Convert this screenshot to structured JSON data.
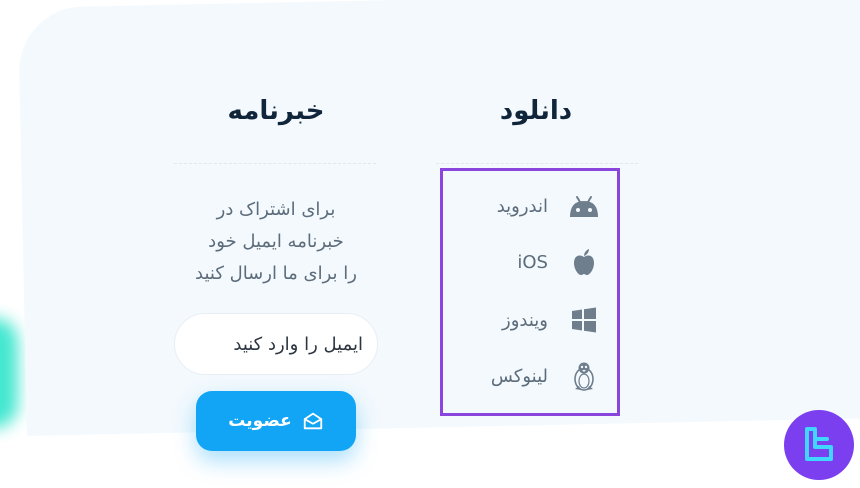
{
  "newsletter": {
    "title": "خبرنامه",
    "description_lines": [
      "برای اشتراک در",
      "خبرنامه ایمیل خود",
      "را برای ما ارسال کنید"
    ],
    "email_placeholder": "ایمیل را وارد کنید",
    "subscribe_label": "عضویت",
    "subscribe_icon": "envelope-open-icon"
  },
  "download": {
    "title": "دانلود",
    "items": [
      {
        "label": "اندروید",
        "icon": "android-icon"
      },
      {
        "label": "iOS",
        "icon": "apple-icon"
      },
      {
        "label": "ویندوز",
        "icon": "windows-icon"
      },
      {
        "label": "لینوکس",
        "icon": "linux-icon"
      }
    ]
  },
  "colors": {
    "accent": "#12a5f5",
    "highlight_border": "#8a45dc",
    "logo_bg": "#7b3ff0",
    "panel_bg": "#f3f9fd"
  }
}
